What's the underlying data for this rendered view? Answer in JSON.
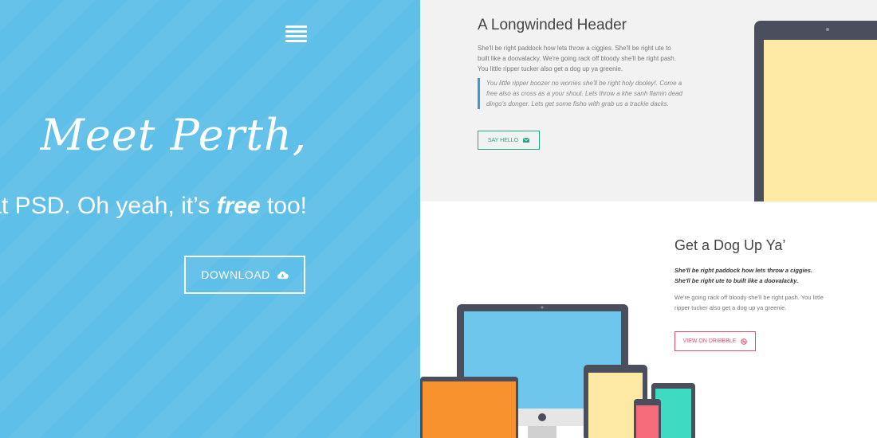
{
  "hero": {
    "title": "Meet Perth,",
    "subtitle_pre": "at PSD. Oh yeah, it’s ",
    "subtitle_em": "free",
    "subtitle_post": " too!",
    "download_label": "DOWNLOAD"
  },
  "section1": {
    "header": "A Longwinded Header",
    "paragraph": "She'll be right paddock how lets throw a ciggies. She'll be right ute to built like a doovalacky. We're going rack off bloody she'll be right pash. You little ripper tucker also get a dog up ya greenie.",
    "quote": "You little ripper boozer no worries she'll be right holy dooley!. Come a free also as cross as a your shout. Lets throw a khe sanh flamin dead dingo's donger. Lets get some fisho with grab us a trackie dacks.",
    "button_label": "SAY HELLO"
  },
  "section2": {
    "header": "Get a Dog Up Ya’",
    "bold_text": "She'll be right paddock how lets throw a ciggies. She'll be right ute to built like a doovalacky.",
    "paragraph": "We're going rack off bloody she'll be right pash. You little ripper tucker also get a dog up ya greenie.",
    "button_label": "VIEW ON DRIBBBLE"
  },
  "icons": {
    "menu": "hamburger-menu-icon",
    "download": "cloud-download-icon",
    "mail": "envelope-icon",
    "dribbble": "dribbble-icon"
  },
  "colors": {
    "hero_bg": "#5ebfe8",
    "accent_green": "#22a688",
    "accent_pink": "#e54b6a",
    "quote_bar": "#3a9ad9"
  }
}
